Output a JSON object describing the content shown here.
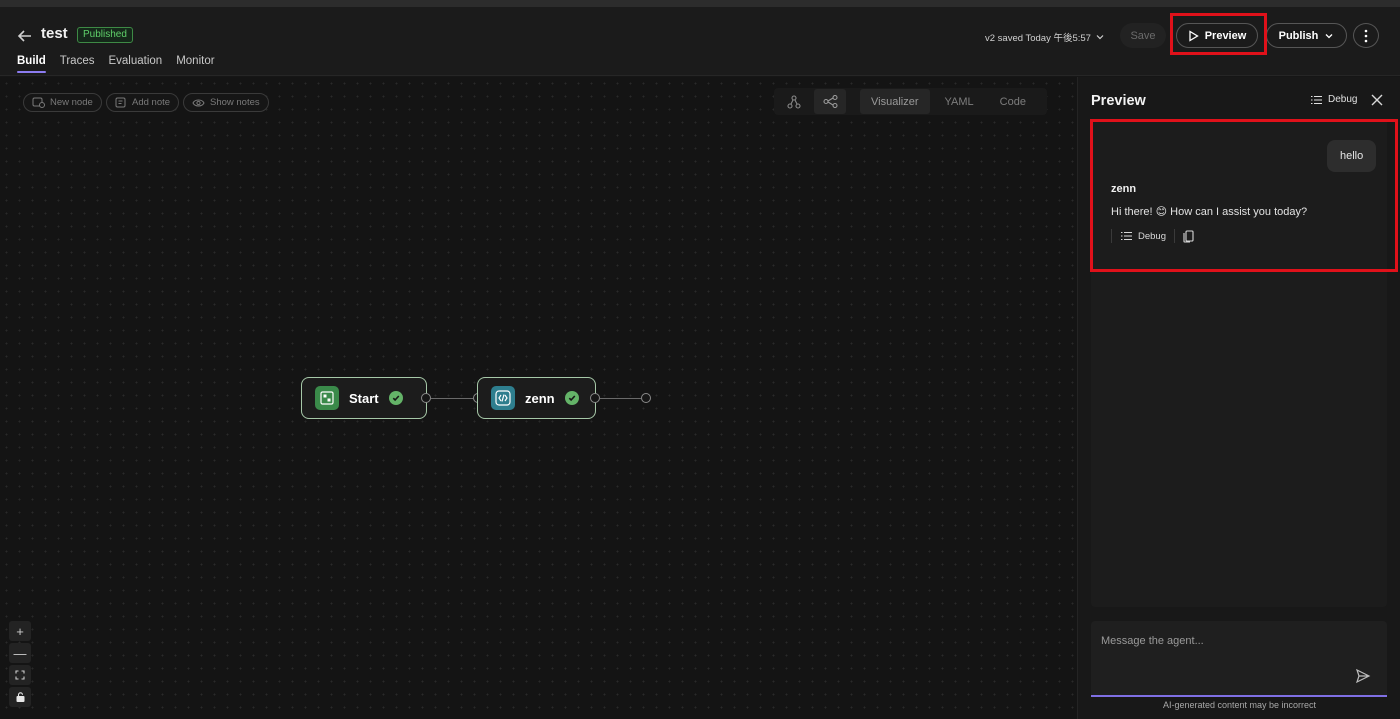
{
  "header": {
    "title": "test",
    "badge": "Published",
    "tabs": [
      {
        "label": "Build",
        "active": true
      },
      {
        "label": "Traces"
      },
      {
        "label": "Evaluation"
      },
      {
        "label": "Monitor"
      }
    ],
    "saved_status": "v2 saved Today 午後5:57",
    "save_label": "Save",
    "preview_label": "Preview",
    "publish_label": "Publish"
  },
  "toolbar": {
    "new_node": "New node",
    "add_note": "Add note",
    "show_notes": "Show notes"
  },
  "view_modes": [
    "Visualizer",
    "YAML",
    "Code"
  ],
  "nodes": [
    {
      "label": "Start",
      "icon": "start-icon"
    },
    {
      "label": "zenn",
      "icon": "code-icon"
    }
  ],
  "zoom_controls": [
    "+",
    "—"
  ],
  "preview": {
    "title": "Preview",
    "debug_label": "Debug",
    "user_message": "hello",
    "agent_name": "zenn",
    "agent_message": "Hi there! 😊 How can I assist you today?",
    "message_debug_label": "Debug",
    "input_placeholder": "Message the agent...",
    "disclaimer": "AI-generated content may be incorrect"
  },
  "colors": {
    "accent": "#8c7cf0",
    "success": "#64b368",
    "highlight": "#e0111a"
  }
}
